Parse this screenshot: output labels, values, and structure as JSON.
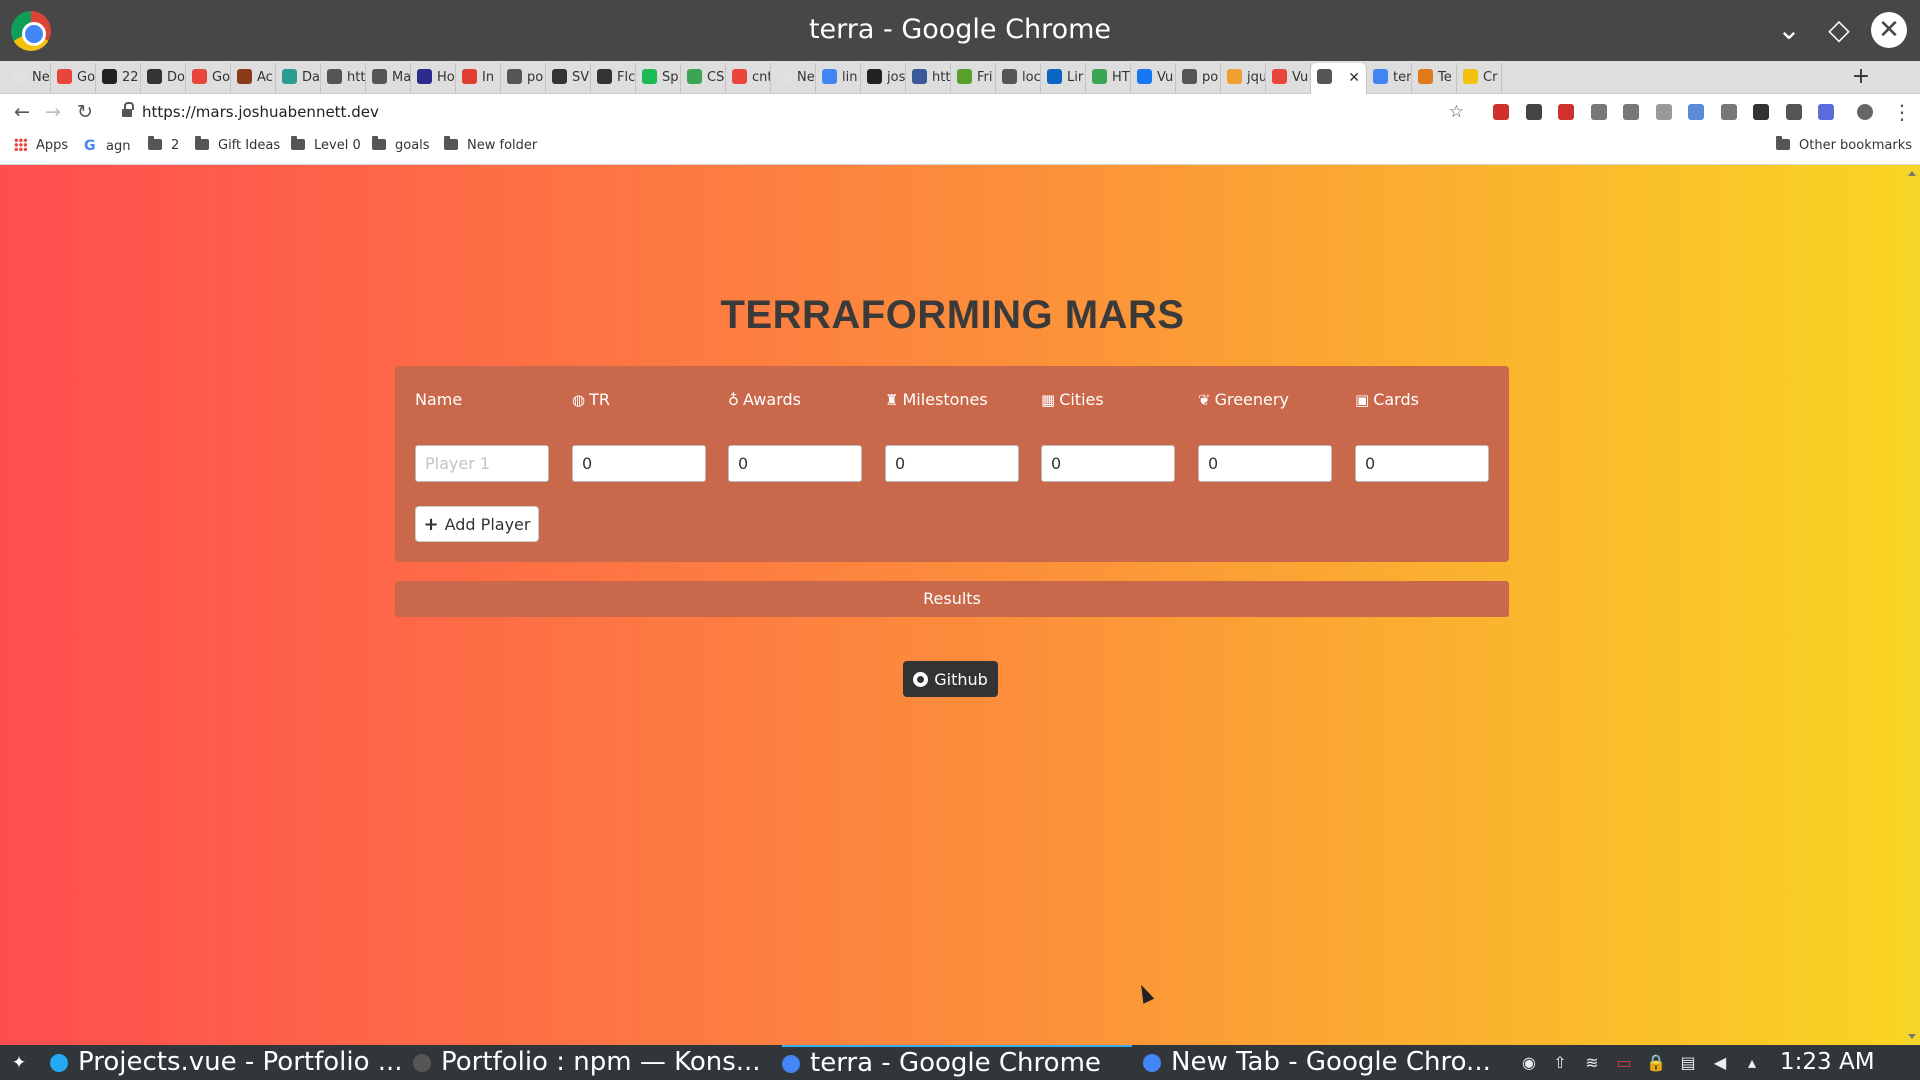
{
  "window": {
    "title": "terra - Google Chrome"
  },
  "tabs": [
    {
      "label": "New T",
      "color": "#e0e0e0"
    },
    {
      "label": "Go",
      "color": "#e8453c"
    },
    {
      "label": "22",
      "color": "#222222"
    },
    {
      "label": "Do",
      "color": "#333333"
    },
    {
      "label": "Go",
      "color": "#e8453c"
    },
    {
      "label": "Ac",
      "color": "#8b3a1a"
    },
    {
      "label": "Da",
      "color": "#2a9d8f"
    },
    {
      "label": "htt",
      "color": "#555555"
    },
    {
      "label": "Ma",
      "color": "#555555"
    },
    {
      "label": "Ho",
      "color": "#2b2b8c"
    },
    {
      "label": "In",
      "color": "#e03c31"
    },
    {
      "label": "po",
      "color": "#555555"
    },
    {
      "label": "SV",
      "color": "#333333"
    },
    {
      "label": "Flc",
      "color": "#333333"
    },
    {
      "label": "Sp",
      "color": "#1db954"
    },
    {
      "label": "CS",
      "color": "#3aa655"
    },
    {
      "label": "cnt",
      "color": "#e8453c"
    },
    {
      "label": "New T",
      "color": "#e0e0e0"
    },
    {
      "label": "lin",
      "color": "#4285f4"
    },
    {
      "label": "jos",
      "color": "#222222"
    },
    {
      "label": "htt",
      "color": "#3b5998"
    },
    {
      "label": "Fri",
      "color": "#5aa02c"
    },
    {
      "label": "loc",
      "color": "#555555"
    },
    {
      "label": "Lir",
      "color": "#0a66c2"
    },
    {
      "label": "HT",
      "color": "#3aa655"
    },
    {
      "label": "Vu",
      "color": "#1877f2"
    },
    {
      "label": "po",
      "color": "#555555"
    },
    {
      "label": "jqu",
      "color": "#f0a030"
    },
    {
      "label": "Vu",
      "color": "#e8453c"
    },
    {
      "label": "",
      "color": "#555555",
      "active": true
    },
    {
      "label": "ter",
      "color": "#4285f4"
    },
    {
      "label": "Te",
      "color": "#e07a1a"
    },
    {
      "label": "Cr",
      "color": "#f4c20d"
    }
  ],
  "toolbar": {
    "url": "https://mars.joshuabennett.dev",
    "back_icon": "←",
    "forward_icon": "→",
    "reload_icon": "↻",
    "bookmark_star": "☆",
    "new_tab": "+",
    "menu": "⋮",
    "extension_colors": [
      "#d0312d",
      "#444444",
      "#d0312d",
      "#777777",
      "#777777",
      "#999999",
      "#5a8dd6",
      "#777777",
      "#333333",
      "#555555",
      "#5b6bdb"
    ]
  },
  "bookmarks": {
    "apps": "Apps",
    "agn": "agn",
    "items": [
      "2",
      "Gift Ideas",
      "Level 0",
      "goals",
      "New folder"
    ],
    "other": "Other bookmarks"
  },
  "app": {
    "title": "TERRAFORMING MARS",
    "columns": [
      {
        "label": "Name",
        "icon": ""
      },
      {
        "label": "TR",
        "icon": "globe-icon",
        "glyph": "◍"
      },
      {
        "label": "Awards",
        "icon": "award-icon",
        "glyph": "♁"
      },
      {
        "label": "Milestones",
        "icon": "trophy-icon",
        "glyph": "♜"
      },
      {
        "label": "Cities",
        "icon": "city-icon",
        "glyph": "▦"
      },
      {
        "label": "Greenery",
        "icon": "leaf-icon",
        "glyph": "❦"
      },
      {
        "label": "Cards",
        "icon": "id-card-icon",
        "glyph": "▣"
      }
    ],
    "player_row": {
      "name_placeholder": "Player 1",
      "values": [
        "0",
        "0",
        "0",
        "0",
        "0",
        "0"
      ]
    },
    "add_player_label": "Add Player",
    "results_label": "Results",
    "github_label": "Github"
  },
  "taskbar": {
    "tasks": [
      {
        "label": "Projects.vue - Portfolio ...",
        "color": "#23a9f2"
      },
      {
        "label": "Portfolio : npm — Kons...",
        "color": "#555555"
      },
      {
        "label": "terra - Google Chrome",
        "color": "#4285f4",
        "active": true
      },
      {
        "label": "New Tab - Google Chro...",
        "color": "#4285f4"
      }
    ],
    "clock": "1:23 AM"
  }
}
